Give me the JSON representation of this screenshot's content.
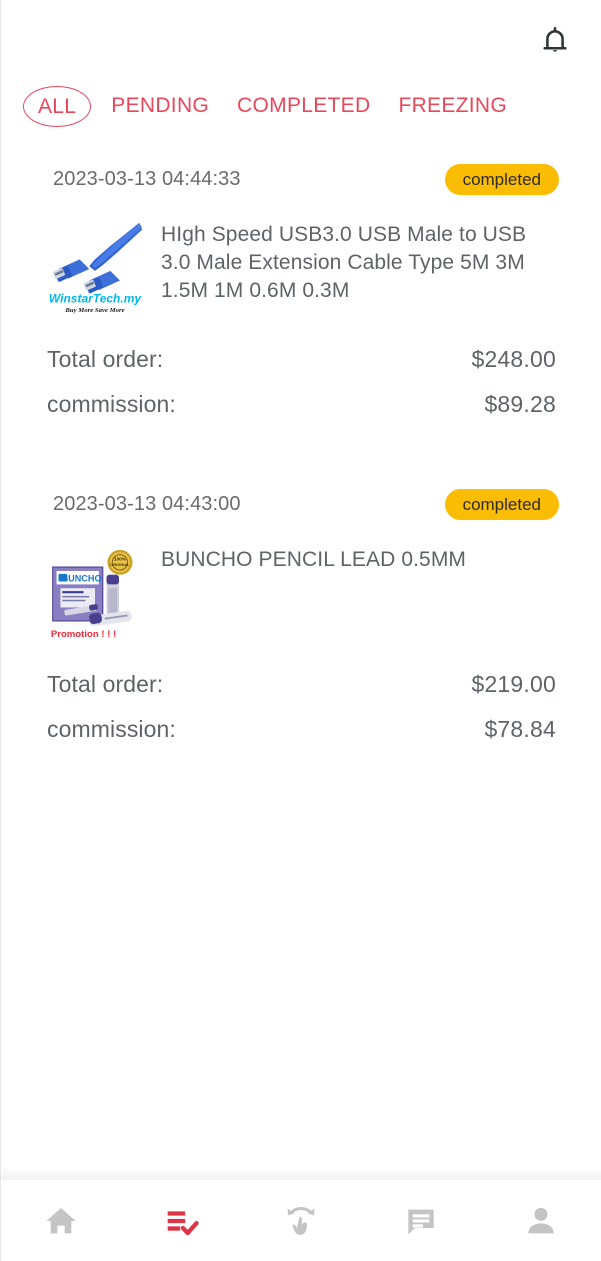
{
  "header": {
    "notification_icon": "bell-icon"
  },
  "tabs": [
    {
      "label": "ALL",
      "active": true
    },
    {
      "label": "PENDING",
      "active": false
    },
    {
      "label": "COMPLETED",
      "active": false
    },
    {
      "label": "FREEZING",
      "active": false
    }
  ],
  "labels": {
    "total_order": "Total order:",
    "commission": "commission:"
  },
  "orders": [
    {
      "date": "2023-03-13 04:44:33",
      "status": "completed",
      "title": "HIgh Speed USB3.0 USB Male to USB 3.0 Male Extension Cable Type 5M 3M 1.5M 1M 0.6M 0.3M",
      "thumbnail": "usb-cable-product-image",
      "thumbnail_brand": "WinstarTech.my",
      "thumbnail_tagline": "Buy More Save More",
      "total_order": "$248.00",
      "commission": "$89.28"
    },
    {
      "date": "2023-03-13 04:43:00",
      "status": "completed",
      "title": "BUNCHO PENCIL LEAD 0.5MM",
      "thumbnail": "buncho-pencil-lead-product-image",
      "thumbnail_brand": "BUNCHO",
      "thumbnail_tagline": "Promotion ! ! !",
      "total_order": "$219.00",
      "commission": "$78.84"
    }
  ],
  "bottom_nav": [
    {
      "icon": "home-icon",
      "active": false
    },
    {
      "icon": "order-list-check-icon",
      "active": true
    },
    {
      "icon": "swipe-gesture-icon",
      "active": false
    },
    {
      "icon": "chat-icon",
      "active": false
    },
    {
      "icon": "person-icon",
      "active": false
    }
  ],
  "colors": {
    "accent_red": "#e8485c",
    "status_amber": "#fbbc04",
    "text_gray": "#5f6368",
    "nav_inactive": "#c4c4c4"
  }
}
